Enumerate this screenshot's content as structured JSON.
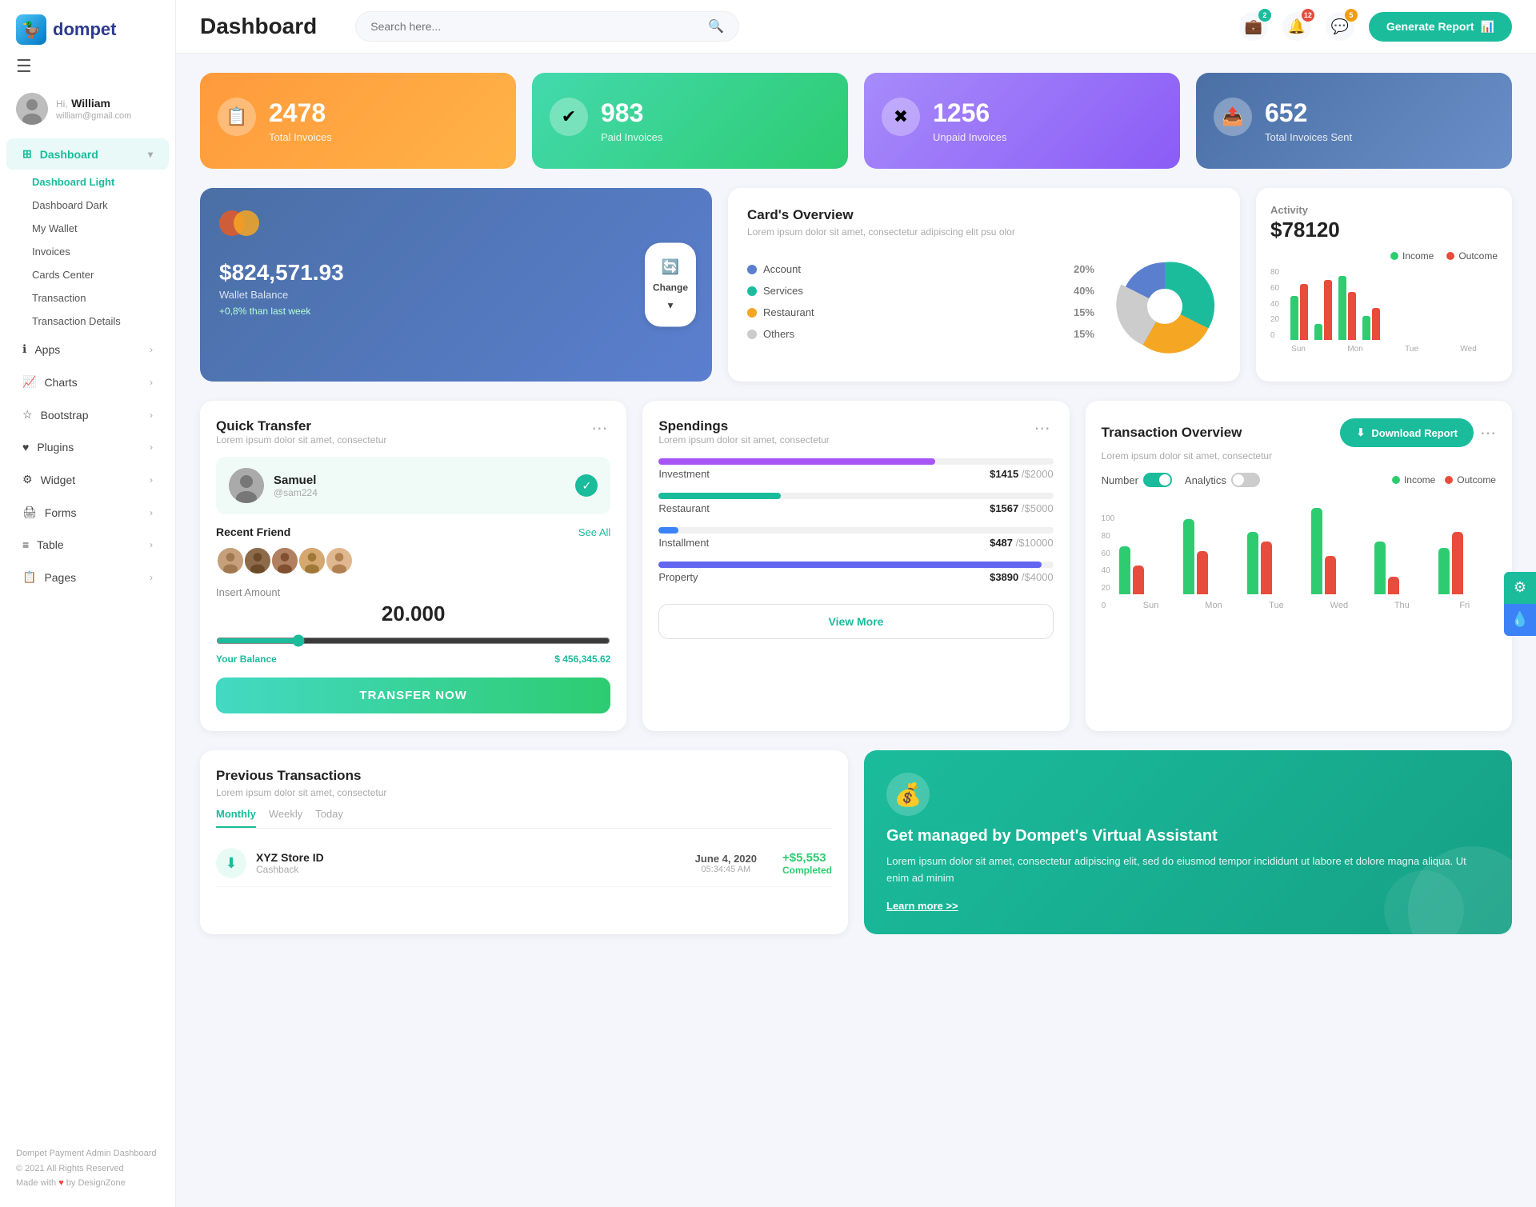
{
  "app": {
    "logo_text": "dompet",
    "header_title": "Dashboard",
    "search_placeholder": "Search here...",
    "generate_report_label": "Generate Report"
  },
  "header_icons": {
    "bell_badge": "2",
    "notif_badge": "12",
    "chat_badge": "5"
  },
  "sidebar": {
    "user_greeting": "Hi,",
    "user_name": "William",
    "user_email": "william@gmail.com",
    "nav_items": [
      {
        "label": "Dashboard",
        "active": true,
        "has_arrow": true
      },
      {
        "label": "Apps",
        "has_arrow": true
      },
      {
        "label": "Charts",
        "has_arrow": true
      },
      {
        "label": "Bootstrap",
        "has_arrow": true
      },
      {
        "label": "Plugins",
        "has_arrow": true
      },
      {
        "label": "Widget",
        "has_arrow": true
      },
      {
        "label": "Forms",
        "has_arrow": true
      },
      {
        "label": "Table",
        "has_arrow": true
      },
      {
        "label": "Pages",
        "has_arrow": true
      }
    ],
    "submenu": [
      {
        "label": "Dashboard Light",
        "active": true
      },
      {
        "label": "Dashboard Dark"
      },
      {
        "label": "My Wallet"
      },
      {
        "label": "Invoices"
      },
      {
        "label": "Cards Center"
      },
      {
        "label": "Transaction"
      },
      {
        "label": "Transaction Details"
      }
    ],
    "footer_line1": "Dompet Payment Admin Dashboard",
    "footer_line2": "© 2021 All Rights Reserved",
    "footer_line3": "Made with ♥ by DesignZone"
  },
  "stats": [
    {
      "number": "2478",
      "label": "Total Invoices",
      "color": "orange"
    },
    {
      "number": "983",
      "label": "Paid Invoices",
      "color": "green"
    },
    {
      "number": "1256",
      "label": "Unpaid Invoices",
      "color": "purple"
    },
    {
      "number": "652",
      "label": "Total Invoices Sent",
      "color": "blue-dark"
    }
  ],
  "wallet": {
    "balance": "$824,571.93",
    "label": "Wallet Balance",
    "change": "+0,8% than last week",
    "btn_label": "Change"
  },
  "cards_overview": {
    "title": "Card's Overview",
    "desc": "Lorem ipsum dolor sit amet, consectetur adipiscing elit psu olor",
    "legend": [
      {
        "label": "Account",
        "pct": "20%",
        "color": "#5b7fcf"
      },
      {
        "label": "Services",
        "pct": "40%",
        "color": "#1abc9c"
      },
      {
        "label": "Restaurant",
        "pct": "15%",
        "color": "#f5a623"
      },
      {
        "label": "Others",
        "pct": "15%",
        "color": "#ccc"
      }
    ]
  },
  "activity": {
    "title": "Activity",
    "amount": "$78120",
    "legend": [
      {
        "label": "Income",
        "color": "#2ecc71"
      },
      {
        "label": "Outcome",
        "color": "#e74c3c"
      }
    ],
    "bars": [
      {
        "income": 55,
        "outcome": 70,
        "label": "Sun"
      },
      {
        "income": 20,
        "outcome": 75,
        "label": "Mon"
      },
      {
        "income": 80,
        "outcome": 60,
        "label": "Tue"
      },
      {
        "income": 30,
        "outcome": 40,
        "label": "Wed"
      }
    ]
  },
  "quick_transfer": {
    "title": "Quick Transfer",
    "desc": "Lorem ipsum dolor sit amet, consectetur",
    "person_name": "Samuel",
    "person_id": "@sam224",
    "friends_label": "Recent Friend",
    "see_all": "See All",
    "amount_label": "Insert Amount",
    "amount_value": "20.000",
    "balance_label": "Your Balance",
    "balance_value": "$ 456,345.62",
    "btn_label": "TRANSFER NOW"
  },
  "spendings": {
    "title": "Spendings",
    "desc": "Lorem ipsum dolor sit amet, consectetur",
    "items": [
      {
        "label": "Investment",
        "current": "$1415",
        "max": "$2000",
        "pct": 70,
        "color": "#a855f7"
      },
      {
        "label": "Restaurant",
        "current": "$1567",
        "max": "$5000",
        "pct": 31,
        "color": "#1abc9c"
      },
      {
        "label": "Installment",
        "current": "$487",
        "max": "$10000",
        "pct": 5,
        "color": "#3b82f6"
      },
      {
        "label": "Property",
        "current": "$3890",
        "max": "$4000",
        "pct": 97,
        "color": "#6366f1"
      }
    ],
    "btn_label": "View More"
  },
  "transaction_overview": {
    "title": "Transaction Overview",
    "desc": "Lorem ipsum dolor sit amet, consectetur",
    "download_btn": "Download Report",
    "toggle_number_label": "Number",
    "toggle_analytics_label": "Analytics",
    "legend": [
      {
        "label": "Income",
        "color": "#2ecc71"
      },
      {
        "label": "Outcome",
        "color": "#e74c3c"
      }
    ],
    "bars": [
      {
        "income": 50,
        "outcome": 30,
        "label": "Sun"
      },
      {
        "income": 78,
        "outcome": 45,
        "label": "Mon"
      },
      {
        "income": 65,
        "outcome": 55,
        "label": "Tue"
      },
      {
        "income": 90,
        "outcome": 40,
        "label": "Wed"
      },
      {
        "income": 55,
        "outcome": 18,
        "label": "Thu"
      },
      {
        "income": 48,
        "outcome": 65,
        "label": "Fri"
      }
    ]
  },
  "prev_transactions": {
    "title": "Previous Transactions",
    "desc": "Lorem ipsum dolor sit amet, consectetur",
    "tabs": [
      "Monthly",
      "Weekly",
      "Today"
    ],
    "active_tab": "Monthly",
    "rows": [
      {
        "name": "XYZ Store ID",
        "type": "Cashback",
        "date": "June 4, 2020",
        "time": "05:34:45 AM",
        "amount": "+$5,553",
        "status": "Completed"
      }
    ]
  },
  "assistant": {
    "title": "Get managed by Dompet's Virtual Assistant",
    "desc": "Lorem ipsum dolor sit amet, consectetur adipiscing elit, sed do eiusmod tempor incididunt ut labore et dolore magna aliqua. Ut enim ad minim",
    "learn_more": "Learn more >>"
  }
}
